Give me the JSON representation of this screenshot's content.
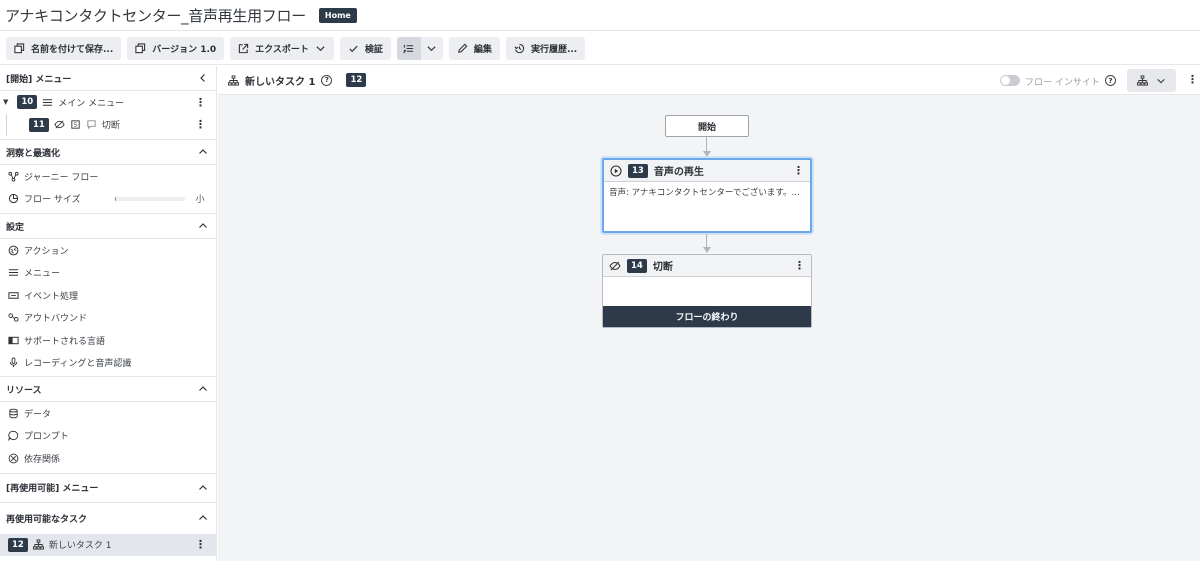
{
  "title": "アナキコンタクトセンター_音声再生用フロー",
  "home_badge": "Home",
  "toolbar": {
    "save_as": "名前を付けて保存...",
    "version": "バージョン 1.0",
    "export": "エクスポート",
    "validate": "検証",
    "edit": "編集",
    "history": "実行履歴..."
  },
  "sidebar": {
    "start_menu": "[開始] メニュー",
    "tree": [
      {
        "num": "10",
        "label": "メイン メニュー"
      },
      {
        "num": "11",
        "label": "切断"
      }
    ],
    "insights_head": "洞察と最適化",
    "insights": [
      {
        "label": "ジャーニー フロー"
      },
      {
        "label": "フロー サイズ",
        "value": "小",
        "level": 0.02
      }
    ],
    "settings_head": "設定",
    "settings": [
      "アクション",
      "メニュー",
      "イベント処理",
      "アウトバウンド",
      "サポートされる言語",
      "レコーディングと音声認識"
    ],
    "resources_head": "リソース",
    "resources": [
      "データ",
      "プロンプト",
      "依存関係"
    ],
    "reusable_menu_head": "[再使用可能] メニュー",
    "reusable_task_head": "再使用可能なタスク",
    "task": {
      "num": "12",
      "label": "新しいタスク 1"
    }
  },
  "canvas": {
    "task_name": "新しいタスク 1",
    "task_num": "12",
    "insight_toggle": "フロー インサイト",
    "start_node": "開始",
    "play_node": {
      "num": "13",
      "title": "音声の再生",
      "body": "音声: アナキコンタクトセンターでございます。..."
    },
    "disconnect_node": {
      "num": "14",
      "title": "切断",
      "end": "フローの終わり"
    }
  }
}
